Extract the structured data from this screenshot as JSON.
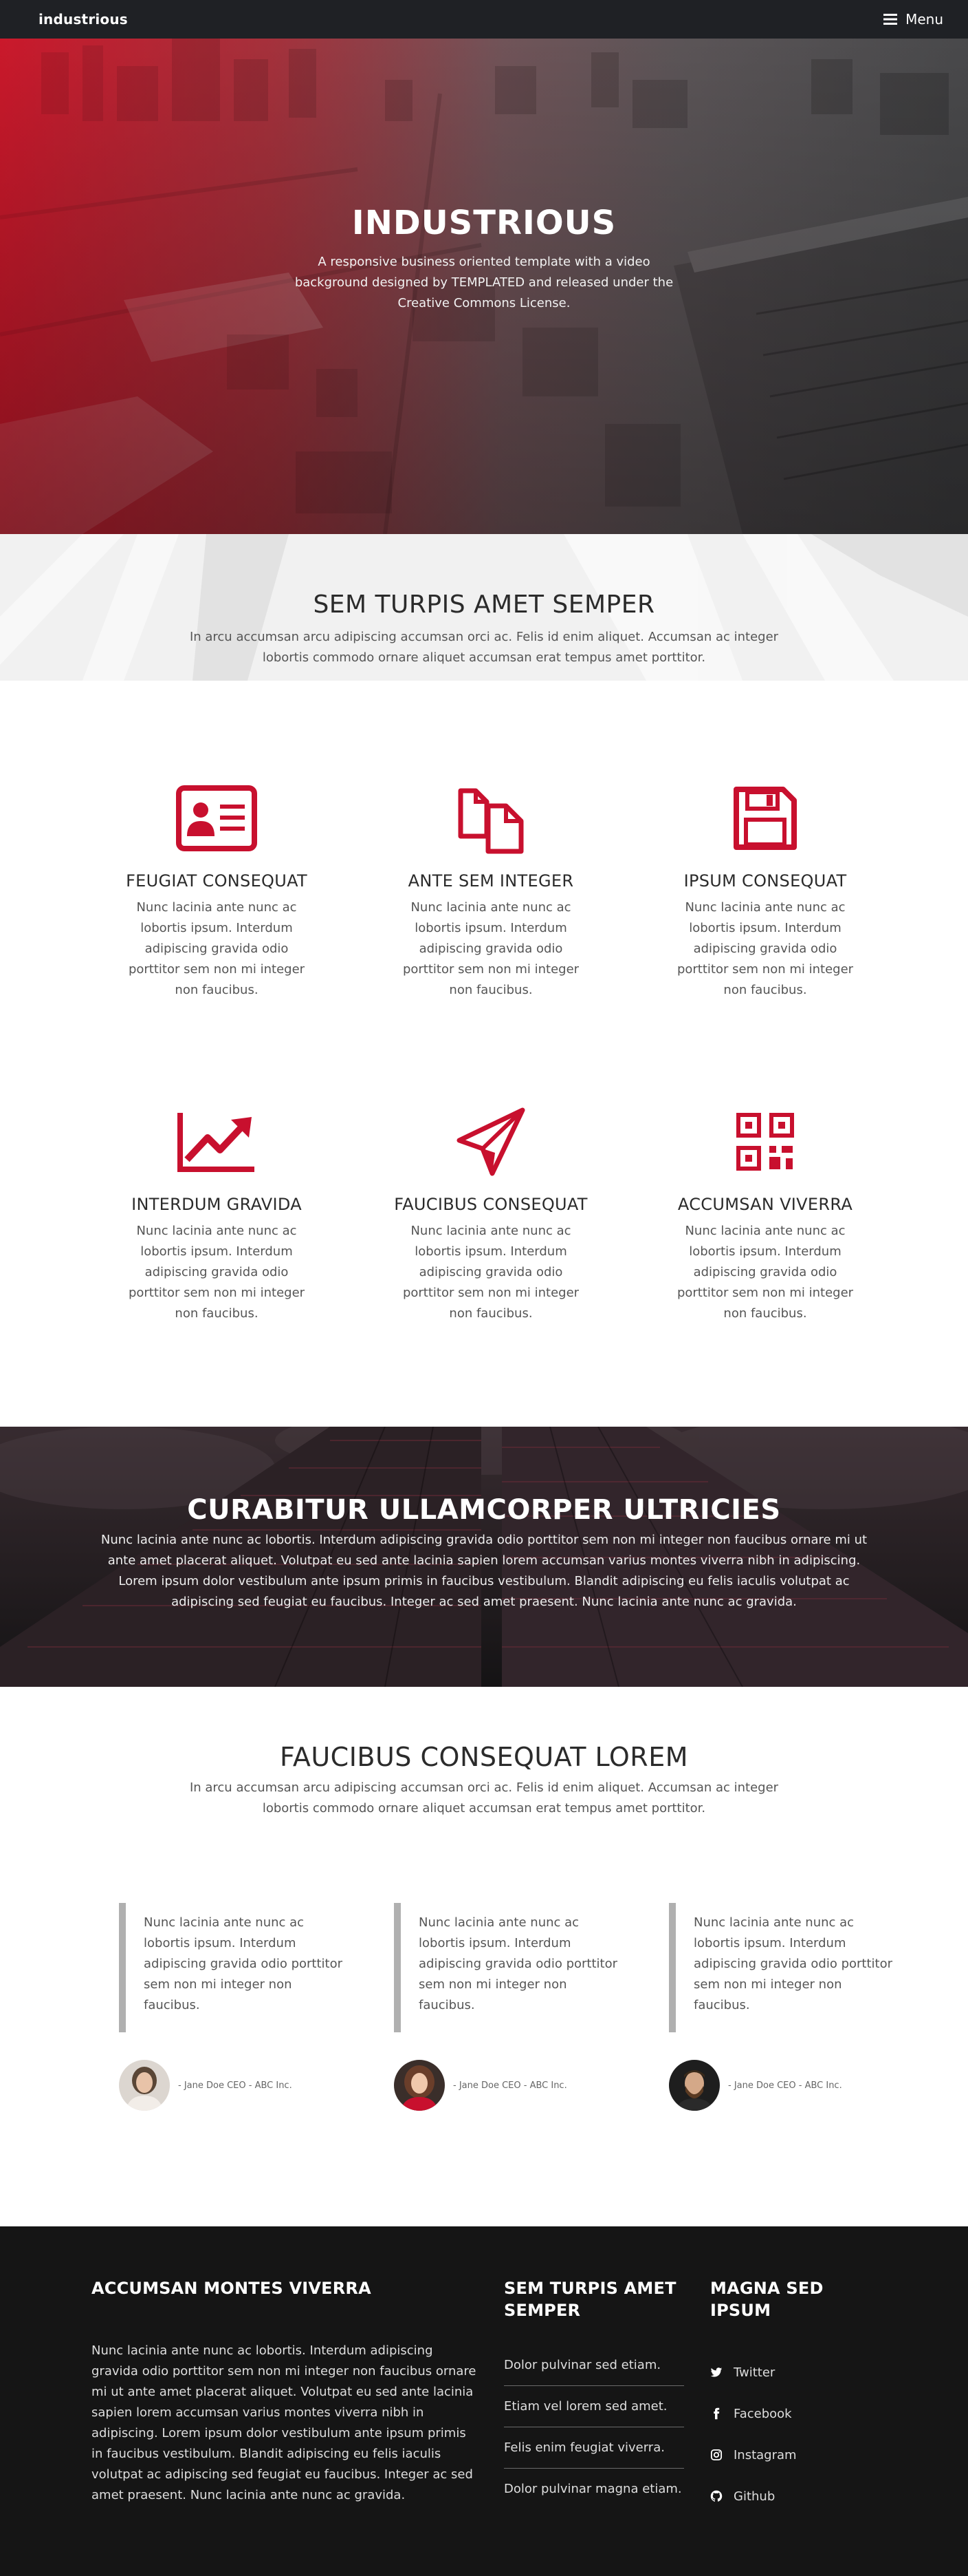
{
  "header": {
    "brand": "industrious",
    "menu_label": "Menu",
    "menu_icon": "hamburger-icon"
  },
  "hero": {
    "title": "INDUSTRIOUS",
    "text": "A responsive business oriented template with a video background designed by TEMPLATED and released under the Creative Commons License."
  },
  "intro": {
    "title": "SEM TURPIS AMET SEMPER",
    "text": "In arcu accumsan arcu adipiscing accumsan orci ac. Felis id enim aliquet. Accumsan ac integer lobortis commodo ornare aliquet accumsan erat tempus amet porttitor."
  },
  "features": [
    {
      "icon": "id-card-icon",
      "title": "FEUGIAT CONSEQUAT",
      "text": "Nunc lacinia ante nunc ac lobortis ipsum. Interdum adipiscing gravida odio porttitor sem non mi integer non faucibus."
    },
    {
      "icon": "copy-files-icon",
      "title": "ANTE SEM INTEGER",
      "text": "Nunc lacinia ante nunc ac lobortis ipsum. Interdum adipiscing gravida odio porttitor sem non mi integer non faucibus."
    },
    {
      "icon": "floppy-disk-icon",
      "title": "IPSUM CONSEQUAT",
      "text": "Nunc lacinia ante nunc ac lobortis ipsum. Interdum adipiscing gravida odio porttitor sem non mi integer non faucibus."
    },
    {
      "icon": "chart-line-icon",
      "title": "INTERDUM GRAVIDA",
      "text": "Nunc lacinia ante nunc ac lobortis ipsum. Interdum adipiscing gravida odio porttitor sem non mi integer non faucibus."
    },
    {
      "icon": "paper-plane-icon",
      "title": "FAUCIBUS CONSEQUAT",
      "text": "Nunc lacinia ante nunc ac lobortis ipsum. Interdum adipiscing gravida odio porttitor sem non mi integer non faucibus."
    },
    {
      "icon": "qr-code-icon",
      "title": "ACCUMSAN VIVERRA",
      "text": "Nunc lacinia ante nunc ac lobortis ipsum. Interdum adipiscing gravida odio porttitor sem non mi integer non faucibus."
    }
  ],
  "banner": {
    "title": "CURABITUR ULLAMCORPER ULTRICIES",
    "text": "Nunc lacinia ante nunc ac lobortis. Interdum adipiscing gravida odio porttitor sem non mi integer non faucibus ornare mi ut ante amet placerat aliquet. Volutpat eu sed ante lacinia sapien lorem accumsan varius montes viverra nibh in adipiscing. Lorem ipsum dolor vestibulum ante ipsum primis in faucibus vestibulum. Blandit adipiscing eu felis iaculis volutpat ac adipiscing sed feugiat eu faucibus. Integer ac sed amet praesent. Nunc lacinia ante nunc ac gravida."
  },
  "testimonials": {
    "title": "FAUCIBUS CONSEQUAT LOREM",
    "text": "In arcu accumsan arcu adipiscing accumsan orci ac. Felis id enim aliquet. Accumsan ac integer lobortis commodo ornare aliquet accumsan erat tempus amet porttitor.",
    "items": [
      {
        "quote": "Nunc lacinia ante nunc ac lobortis ipsum. Interdum adipiscing gravida odio porttitor sem non mi integer non faucibus.",
        "credit": "- Jane Doe CEO - ABC Inc."
      },
      {
        "quote": "Nunc lacinia ante nunc ac lobortis ipsum. Interdum adipiscing gravida odio porttitor sem non mi integer non faucibus.",
        "credit": "- Jane Doe CEO - ABC Inc."
      },
      {
        "quote": "Nunc lacinia ante nunc ac lobortis ipsum. Interdum adipiscing gravida odio porttitor sem non mi integer non faucibus.",
        "credit": "- Jane Doe CEO - ABC Inc."
      }
    ]
  },
  "footer": {
    "about": {
      "title": "ACCUMSAN MONTES VIVERRA",
      "text": "Nunc lacinia ante nunc ac lobortis. Interdum adipiscing gravida odio porttitor sem non mi integer non faucibus ornare mi ut ante amet placerat aliquet. Volutpat eu sed ante lacinia sapien lorem accumsan varius montes viverra nibh in adipiscing. Lorem ipsum dolor vestibulum ante ipsum primis in faucibus vestibulum. Blandit adipiscing eu felis iaculis volutpat ac adipiscing sed feugiat eu faucibus. Integer ac sed amet praesent. Nunc lacinia ante nunc ac gravida."
    },
    "links": {
      "title": "SEM TURPIS AMET SEMPER",
      "items": [
        "Dolor pulvinar sed etiam.",
        "Etiam vel lorem sed amet.",
        "Felis enim feugiat viverra.",
        "Dolor pulvinar magna etiam."
      ]
    },
    "social": {
      "title": "MAGNA SED IPSUM",
      "items": [
        {
          "icon": "twitter-icon",
          "label": "Twitter"
        },
        {
          "icon": "facebook-icon",
          "label": "Facebook"
        },
        {
          "icon": "instagram-icon",
          "label": "Instagram"
        },
        {
          "icon": "github-icon",
          "label": "Github"
        }
      ]
    }
  },
  "colors": {
    "accent": "#c8102e",
    "header_bg": "#1f2125",
    "footer_bg": "#151515",
    "quote_border": "#b0b0b0"
  }
}
